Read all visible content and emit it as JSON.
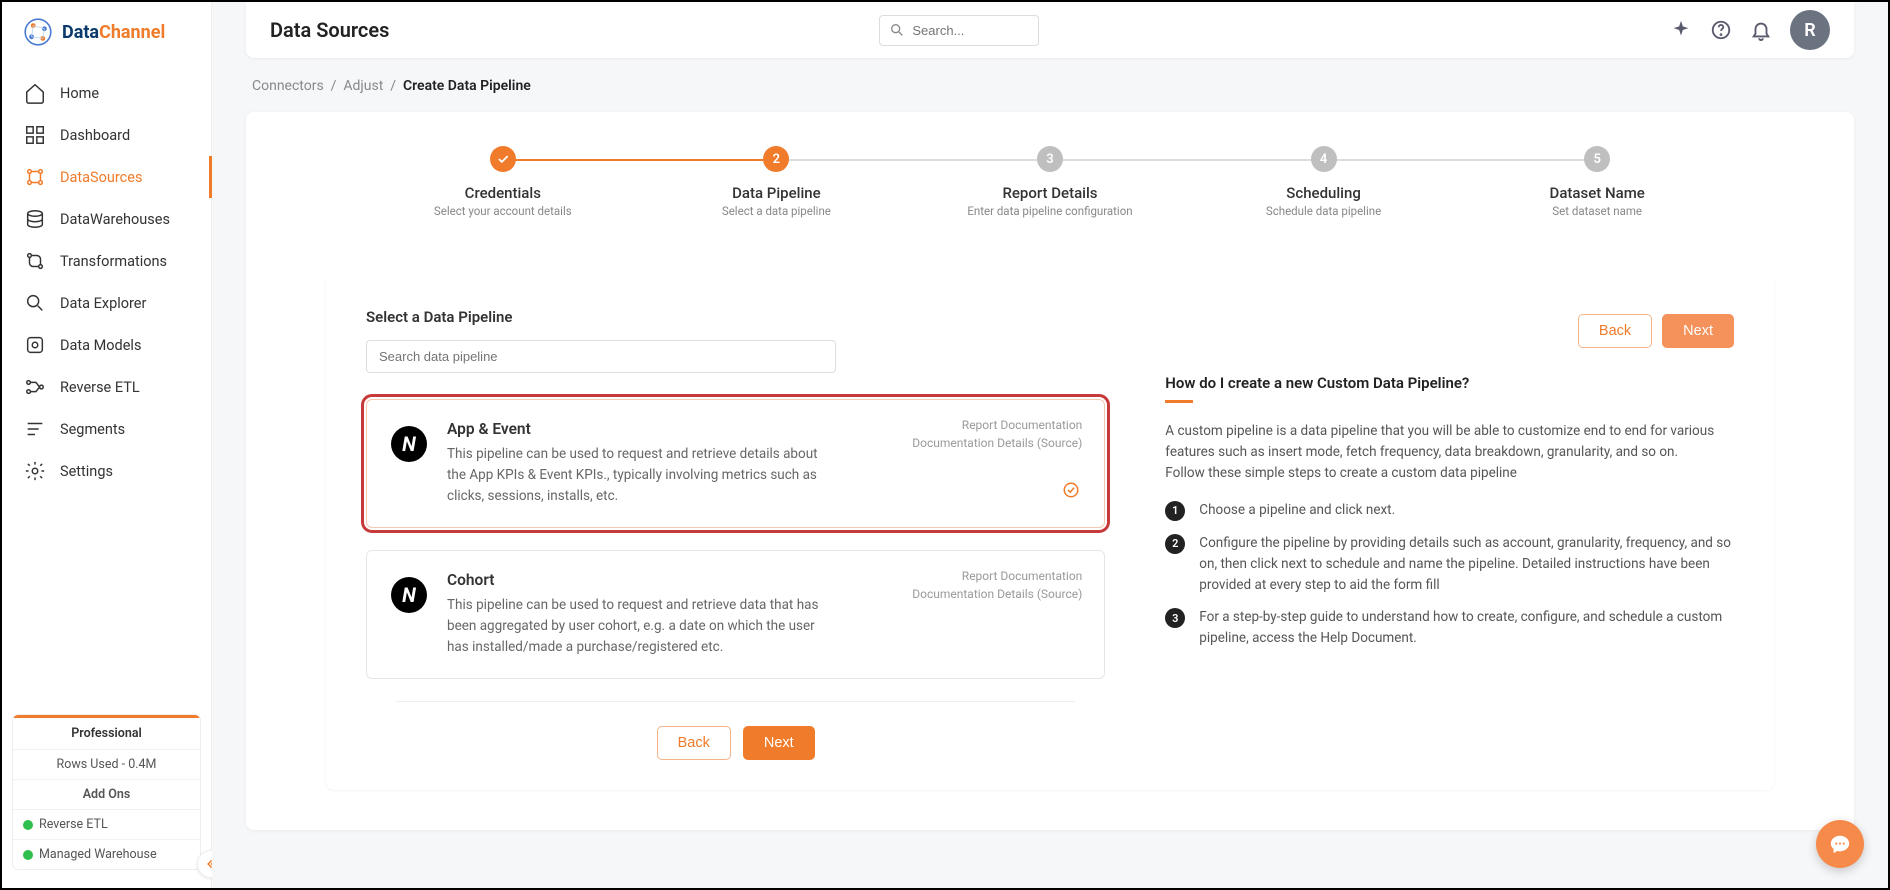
{
  "brand": {
    "part1": "Data",
    "part2": "Channel"
  },
  "sidebar": {
    "items": [
      {
        "label": "Home"
      },
      {
        "label": "Dashboard"
      },
      {
        "label": "DataSources"
      },
      {
        "label": "DataWarehouses"
      },
      {
        "label": "Transformations"
      },
      {
        "label": "Data Explorer"
      },
      {
        "label": "Data Models"
      },
      {
        "label": "Reverse ETL"
      },
      {
        "label": "Segments"
      },
      {
        "label": "Settings"
      }
    ],
    "plan": {
      "tier": "Professional",
      "rows": "Rows Used - 0.4M",
      "addons_label": "Add Ons",
      "addons": [
        "Reverse ETL",
        "Managed Warehouse"
      ]
    }
  },
  "header": {
    "title": "Data Sources",
    "search_placeholder": "Search...",
    "avatar_initial": "R"
  },
  "breadcrumb": {
    "items": [
      "Connectors",
      "Adjust"
    ],
    "current": "Create Data Pipeline"
  },
  "stepper": [
    {
      "title": "Credentials",
      "sub": "Select your account details",
      "state": "complete"
    },
    {
      "title": "Data Pipeline",
      "sub": "Select a data pipeline",
      "state": "active",
      "num": "2"
    },
    {
      "title": "Report Details",
      "sub": "Enter data pipeline configuration",
      "state": "pending",
      "num": "3"
    },
    {
      "title": "Scheduling",
      "sub": "Schedule data pipeline",
      "state": "pending",
      "num": "4"
    },
    {
      "title": "Dataset Name",
      "sub": "Set dataset name",
      "state": "pending",
      "num": "5"
    }
  ],
  "pipeline_panel": {
    "section_title": "Select a Data Pipeline",
    "search_placeholder": "Search data pipeline",
    "back_label": "Back",
    "next_label": "Next",
    "doc_link1": "Report Documentation",
    "doc_link2": "Documentation Details (Source)",
    "pipelines": [
      {
        "name": "App & Event",
        "desc": "This pipeline can be used to request and retrieve details about the App KPIs & Event KPIs., typically involving metrics such as clicks, sessions, installs, etc.",
        "selected": true
      },
      {
        "name": "Cohort",
        "desc": "This pipeline can be used to request and retrieve data that has been aggregated by user cohort, e.g. a date on which the user has installed/made a purchase/registered etc.",
        "selected": false
      }
    ]
  },
  "help": {
    "title": "How do I create a new Custom Data Pipeline?",
    "intro": "A custom pipeline is a data pipeline that you will be able to customize end to end for various features such as insert mode, fetch frequency, data breakdown, granularity, and so on.\nFollow these simple steps to create a custom data pipeline",
    "steps": [
      "Choose a pipeline and click next.",
      "Configure the pipeline by providing details such as account, granularity, frequency, and so on, then click next to schedule and name the pipeline. Detailed instructions have been provided at every step to aid the form fill",
      "For a step-by-step guide to understand how to create, configure, and schedule a custom pipeline, access the Help Document."
    ]
  }
}
